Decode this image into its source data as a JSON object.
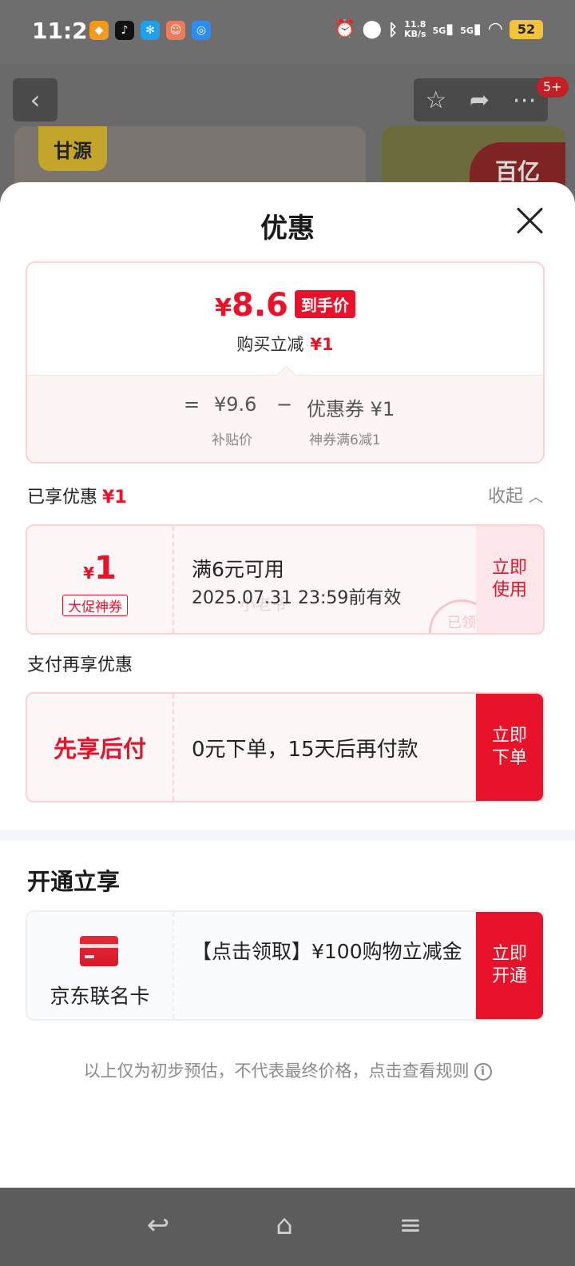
{
  "status_bar": {
    "time": "11:21",
    "net_speed_value": "11.8",
    "net_speed_unit": "KB/s",
    "sig1": "5G",
    "sig2": "5G",
    "battery": "52"
  },
  "background": {
    "badge": "5+",
    "left_logo": "甘源",
    "right_logo": "百亿"
  },
  "sheet": {
    "title": "优惠"
  },
  "summary": {
    "final_price_symbol": "¥",
    "final_price": "8.6",
    "price_tag": "到手价",
    "reduce_label": "购买立减",
    "reduce_amount": "¥1",
    "equals": "=",
    "subsidy_price": "¥9.6",
    "minus": "−",
    "coupon_label": "优惠券 ¥1",
    "subsidy_caption": "补贴价",
    "coupon_caption": "神券满6减1"
  },
  "enjoyed": {
    "label": "已享优惠",
    "amount": "¥1",
    "collapse": "收起",
    "coupon": {
      "symbol": "¥",
      "amount": "1",
      "type": "大促神券",
      "condition": "满6元可用",
      "validity": "2025.07.31 23:59前有效",
      "stamp": "已领",
      "watermark": "小老爷",
      "button": "立即\n使用"
    }
  },
  "payment": {
    "label": "支付再享优惠",
    "title": "先享后付",
    "desc": "0元下单，15天后再付款",
    "button": "立即\n下单"
  },
  "open_offer": {
    "title": "开通立享",
    "card_name": "京东联名卡",
    "desc": "【点击领取】¥100购物立减金",
    "button": "立即\n开通"
  },
  "disclaimer": "以上仅为初步预估，不代表最终价格，点击查看规则",
  "colors": {
    "accent_red": "#e8132a",
    "light_pink": "#fdf6f7"
  }
}
